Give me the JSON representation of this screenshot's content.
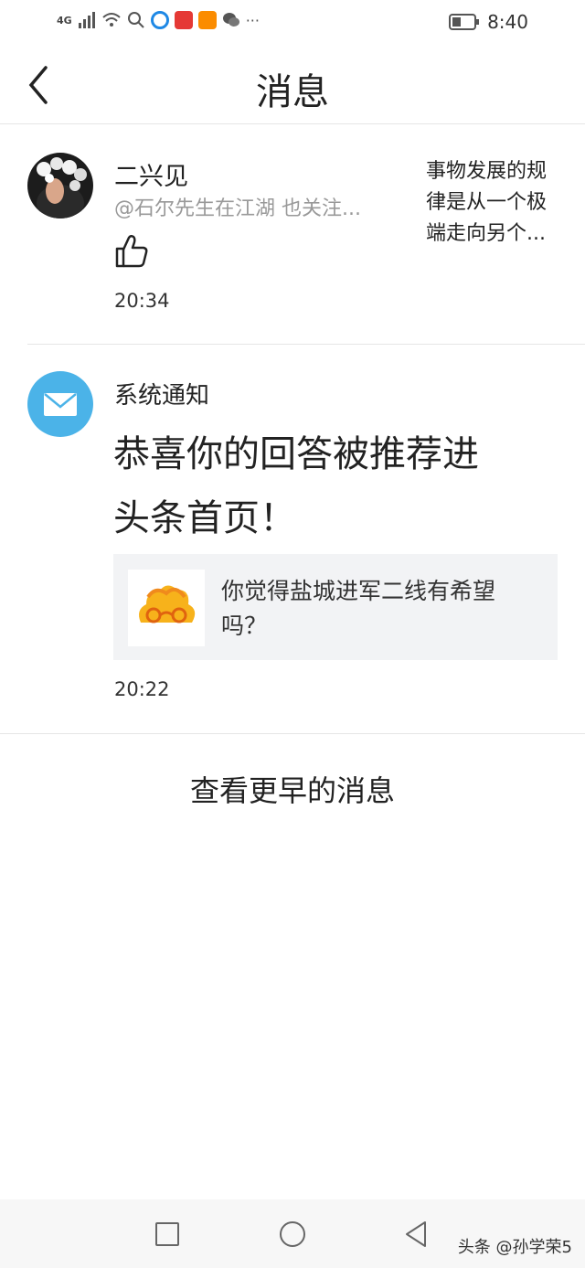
{
  "status_bar": {
    "network": "4G",
    "time": "8:40",
    "icons": [
      "signal-icon",
      "wifi-icon",
      "search-icon",
      "app-icon",
      "app-icon",
      "video-icon",
      "wechat-icon",
      "more-icon",
      "battery-icon"
    ]
  },
  "header": {
    "title": "消息",
    "back_icon": "chevron-left-icon"
  },
  "messages": [
    {
      "user": "二兴见",
      "mention": "@石尔先生在江湖 也关注...",
      "action_icon": "thumbs-up-icon",
      "time": "20:34",
      "snippet_lines": [
        "事物发展的规",
        "律是从一个极",
        "端走向另个..."
      ]
    },
    {
      "sender": "系统通知",
      "headline_lines": [
        "恭喜你的回答被推荐进",
        "头条首页！"
      ],
      "quote_lines": [
        "你觉得盐城进军二线有希望",
        "吗？"
      ],
      "time": "20:22",
      "avatar_color": "#4bb3e8"
    }
  ],
  "view_earlier": "查看更早的消息",
  "nav": {
    "icons": [
      "square-icon",
      "circle-icon",
      "triangle-back-icon"
    ],
    "watermark": "头条 @孙学荣5"
  }
}
